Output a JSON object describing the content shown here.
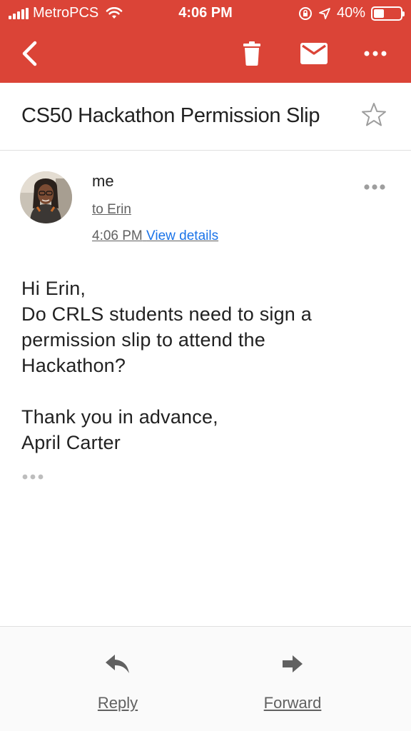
{
  "status_bar": {
    "carrier": "MetroPCS",
    "time": "4:06 PM",
    "battery_text": "40%",
    "battery_level": 0.4
  },
  "toolbar": {
    "back_icon": "chevron-left-icon",
    "delete_icon": "trash-icon",
    "mark_unread_icon": "mail-icon",
    "more_icon": "more-horizontal-icon"
  },
  "email": {
    "subject": "CS50 Hackathon Permission Slip",
    "sender": "me",
    "to": "to Erin",
    "time": "4:06 PM",
    "view_details": "View details",
    "body": {
      "greeting": "Hi Erin,",
      "line1": "Do CRLS students need to sign a",
      "line2": "permission slip to attend the",
      "line3": "Hackathon?",
      "closing": "Thank you in advance,",
      "signature": "April Carter"
    }
  },
  "actions": {
    "reply": "Reply",
    "forward": "Forward"
  },
  "colors": {
    "accent": "#db4437",
    "link": "#1a73e8",
    "text": "#212121",
    "muted": "#616161"
  }
}
